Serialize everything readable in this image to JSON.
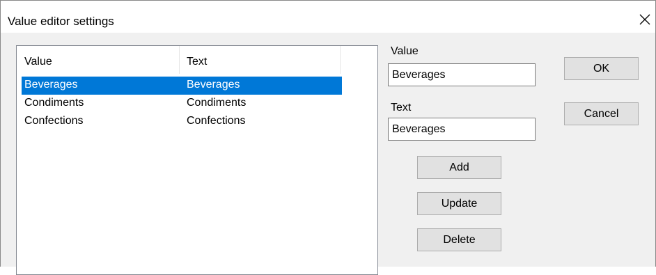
{
  "window": {
    "title": "Value editor settings",
    "close_glyph": "✕"
  },
  "list": {
    "columns": [
      "Value",
      "Text"
    ],
    "rows": [
      {
        "value": "Beverages",
        "text": "Beverages",
        "selected": true
      },
      {
        "value": "Condiments",
        "text": "Condiments",
        "selected": false
      },
      {
        "value": "Confections",
        "text": "Confections",
        "selected": false
      }
    ]
  },
  "fields": {
    "value_label": "Value",
    "value_input": "Beverages",
    "text_label": "Text",
    "text_input": "Beverages"
  },
  "buttons": {
    "ok": "OK",
    "cancel": "Cancel",
    "add": "Add",
    "update": "Update",
    "delete": "Delete"
  },
  "colors": {
    "selection": "#0078d7",
    "dialog_bg": "#f0f0f0"
  }
}
